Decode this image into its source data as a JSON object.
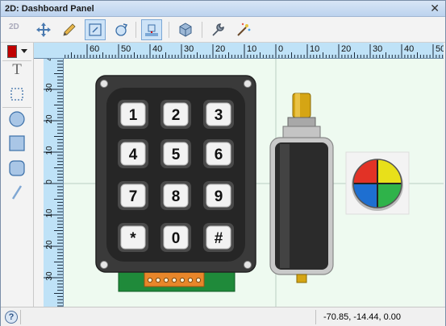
{
  "window": {
    "title": "2D: Dashboard Panel",
    "close_glyph": "✕"
  },
  "toolbar": {
    "mode_label": "2D",
    "buttons": [
      {
        "name": "move-icon"
      },
      {
        "name": "pencil-icon"
      },
      {
        "name": "select-frame-icon",
        "active": true
      },
      {
        "name": "rotate-icon"
      },
      {
        "name": "snap-grid-icon",
        "active": true
      },
      {
        "name": "cube-icon"
      },
      {
        "name": "wrench-icon"
      },
      {
        "name": "wizard-icon"
      }
    ]
  },
  "left_tools": {
    "color": "#c00000",
    "items": [
      "text-tool-icon",
      "select-rect-icon",
      "circle-icon",
      "rectangle-icon",
      "rounded-rect-icon",
      "line-icon"
    ],
    "text_glyph": "T"
  },
  "ruler_h": {
    "labels": [
      "60",
      "50",
      "40",
      "30",
      "20",
      "10",
      "0",
      "10",
      "20",
      "30",
      "40",
      "50"
    ]
  },
  "ruler_v": {
    "labels": [
      "40",
      "30",
      "20",
      "10",
      "0",
      "10",
      "20",
      "30"
    ]
  },
  "keypad": {
    "keys": [
      "1",
      "2",
      "3",
      "4",
      "5",
      "6",
      "7",
      "8",
      "9",
      "*",
      "0",
      "#"
    ]
  },
  "colorwheel": {
    "colors": [
      "#e8e01a",
      "#e23226",
      "#1e6fd1",
      "#2fb34a"
    ]
  },
  "status": {
    "coordinates": "-70.85, -14.44, 0.00",
    "help_glyph": "?"
  }
}
